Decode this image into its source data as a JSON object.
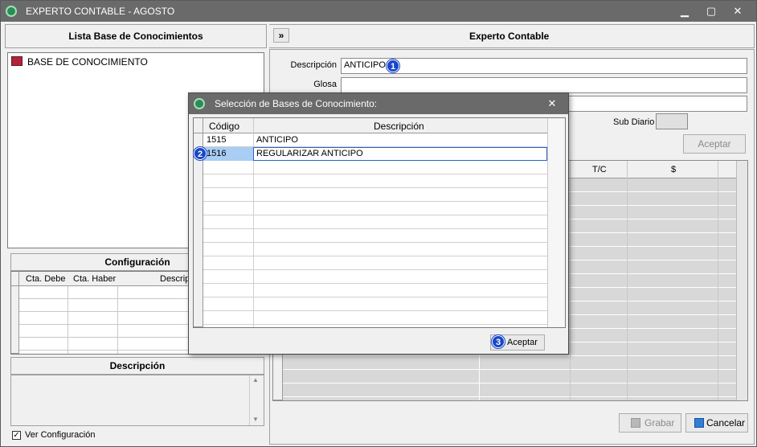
{
  "window": {
    "title": "EXPERTO CONTABLE - AGOSTO",
    "min": "▁",
    "max": "▢",
    "close": "✕"
  },
  "left": {
    "header": "Lista Base de Conocimientos",
    "tree_item": "BASE DE CONOCIMIENTO",
    "config": {
      "header": "Configuración",
      "columns": [
        "Cta. Debe",
        "Cta. Haber",
        "Descrip"
      ]
    },
    "desc_header": "Descripción",
    "ver_config": "Ver Configuración"
  },
  "right": {
    "expand": "»",
    "header": "Experto Contable",
    "descripcion_label": "Descripción",
    "descripcion_value": "ANTICIPO",
    "glosa_label": "Glosa",
    "subdiario_label": "Sub Diario",
    "aceptar": "Aceptar",
    "grid_columns": [
      "T/C",
      "$"
    ],
    "grabar": "Grabar",
    "cancelar": "Cancelar"
  },
  "dialog": {
    "title": "Selección de Bases de Conocimiento:",
    "close": "✕",
    "columns": [
      "Código",
      "Descripción"
    ],
    "rows": [
      {
        "code": "1515",
        "desc": "ANTICIPO"
      },
      {
        "code": "1516",
        "desc": "REGULARIZAR ANTICIPO"
      }
    ],
    "aceptar": "Aceptar"
  },
  "badges": [
    "1",
    "2",
    "3"
  ]
}
